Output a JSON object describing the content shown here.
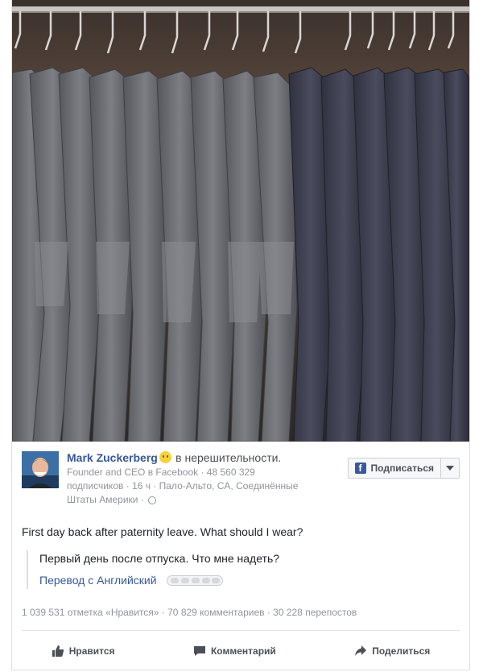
{
  "post": {
    "author": "Mark Zuckerberg",
    "mood": "в нерешительности.",
    "meta_line1": "Founder and CEO в Facebook · 48 560 329",
    "meta_line2": "подписчиков · 16 ч · Пало-Альто, CA, Соединённые",
    "meta_line3": "Штаты Америки ·",
    "follow_label": "Подписаться",
    "status": "First day back after paternity leave. What should I wear?",
    "translation_text": "Первый день после отпуска. Что мне надеть?",
    "translation_link": "Перевод с Английский",
    "stats": "1 039 531 отметка «Нравится» · 70 829 комментариев · 30 228 перепостов"
  },
  "actions": {
    "like": "Нравится",
    "comment": "Комментарий",
    "share": "Поделиться"
  },
  "icons": {
    "like": "thumbs-up-icon",
    "comment": "comment-icon",
    "share": "share-icon",
    "facebook": "facebook-icon",
    "globe": "globe-icon"
  },
  "colors": {
    "link": "#365899",
    "muted": "#90949c",
    "brand": "#3b5998"
  }
}
